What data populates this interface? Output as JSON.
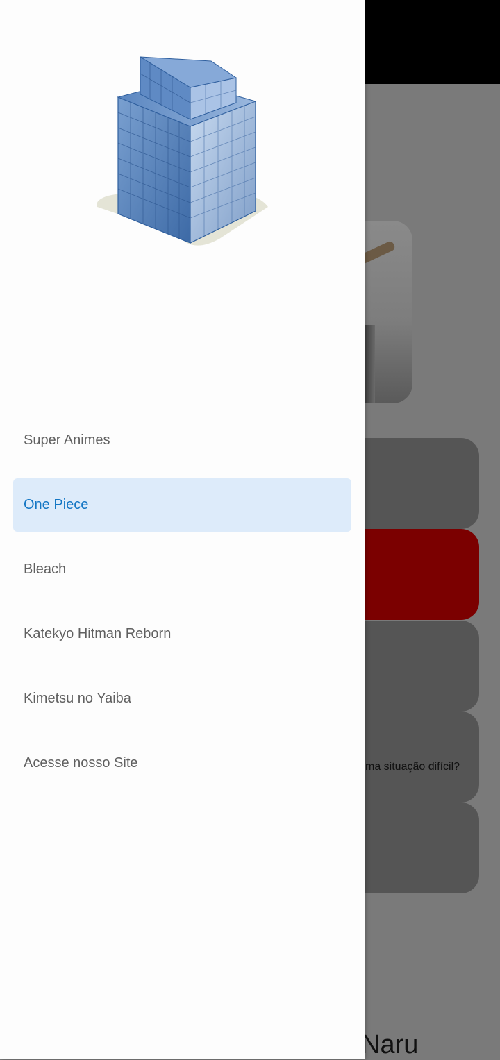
{
  "background": {
    "card_text": "ma situação difícil?",
    "page_title_fragment": "Naru"
  },
  "drawer": {
    "logo_icon": "office-building-icon",
    "items": [
      {
        "label": "Super Animes",
        "active": false
      },
      {
        "label": "One Piece",
        "active": true
      },
      {
        "label": "Bleach",
        "active": false
      },
      {
        "label": "Katekyo Hitman Reborn",
        "active": false
      },
      {
        "label": "Kimetsu no Yaiba",
        "active": false
      },
      {
        "label": "Acesse nosso Site",
        "active": false
      }
    ]
  },
  "colors": {
    "active_item_bg": "#ddebfa",
    "active_item_text": "#1376c4",
    "accent_red": "#7b0000"
  }
}
